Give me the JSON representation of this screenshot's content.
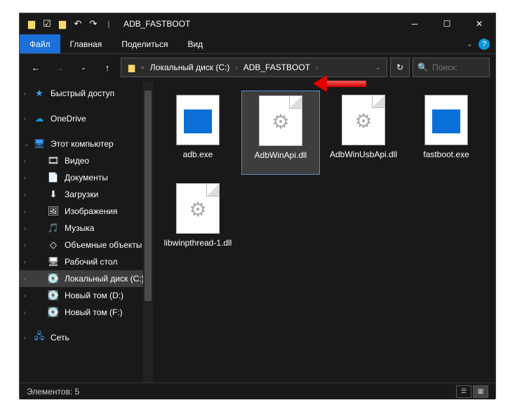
{
  "window": {
    "title": "ADB_FASTBOOT"
  },
  "ribbon": {
    "file_tab": "Файл",
    "tabs": [
      "Главная",
      "Поделиться",
      "Вид"
    ]
  },
  "breadcrumb": {
    "chev_prefix": "«",
    "segments": [
      "Локальный диск (C:)",
      "ADB_FASTBOOT"
    ]
  },
  "search": {
    "placeholder": "Поиск:"
  },
  "sidebar": {
    "quick_access": "Быстрый доступ",
    "onedrive": "OneDrive",
    "this_pc": "Этот компьютер",
    "items": [
      {
        "label": "Видео",
        "icon": "🎞"
      },
      {
        "label": "Документы",
        "icon": "📄"
      },
      {
        "label": "Загрузки",
        "icon": "⬇"
      },
      {
        "label": "Изображения",
        "icon": "🖼"
      },
      {
        "label": "Музыка",
        "icon": "🎵"
      },
      {
        "label": "Объемные объекты",
        "icon": "◇"
      },
      {
        "label": "Рабочий стол",
        "icon": "🖥"
      },
      {
        "label": "Локальный диск (C:)",
        "icon": "💽"
      },
      {
        "label": "Новый том (D:)",
        "icon": "💽"
      },
      {
        "label": "Новый том (F:)",
        "icon": "💽"
      }
    ],
    "network": "Сеть"
  },
  "files": [
    {
      "name": "adb.exe",
      "type": "exe"
    },
    {
      "name": "AdbWinApi.dll",
      "type": "dll",
      "selected": true
    },
    {
      "name": "AdbWinUsbApi.dll",
      "type": "dll"
    },
    {
      "name": "fastboot.exe",
      "type": "exe"
    },
    {
      "name": "libwinpthread-1.dll",
      "type": "dll"
    }
  ],
  "status": {
    "count_label": "Элементов: 5"
  }
}
